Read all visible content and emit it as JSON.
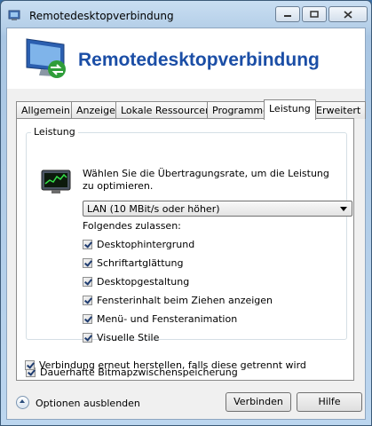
{
  "window": {
    "title": "Remotedesktopverbindung",
    "controls": {
      "minimize": "minimize-icon",
      "maximize": "maximize-icon",
      "close": "close-icon"
    }
  },
  "banner": {
    "title": "Remotedesktopverbindung",
    "icon": "remote-desktop-icon"
  },
  "tabs": [
    {
      "label": "Allgemein",
      "active": false
    },
    {
      "label": "Anzeige",
      "active": false
    },
    {
      "label": "Lokale Ressourcen",
      "active": false
    },
    {
      "label": "Programme",
      "active": false
    },
    {
      "label": "Leistung",
      "active": true
    },
    {
      "label": "Erweitert",
      "active": false
    }
  ],
  "performance": {
    "group_label": "Leistung",
    "description": "Wählen Sie die Übertragungsrate, um die Leistung zu optimieren.",
    "connection_speed": "LAN (10 MBit/s oder höher)",
    "allow_label": "Folgendes zulassen:",
    "options": [
      {
        "label": "Desktophintergrund",
        "checked": true
      },
      {
        "label": "Schriftartglättung",
        "checked": true
      },
      {
        "label": "Desktopgestaltung",
        "checked": true
      },
      {
        "label": "Fensterinhalt beim Ziehen anzeigen",
        "checked": true
      },
      {
        "label": "Menü- und Fensteranimation",
        "checked": true
      },
      {
        "label": "Visuelle Stile",
        "checked": true
      }
    ],
    "bitmap_cache": {
      "label": "Dauerhafte Bitmapzwischenspeicherung",
      "checked": true
    },
    "reconnect": {
      "label": "Verbindung erneut herstellen, falls diese getrennt wird",
      "checked": true
    }
  },
  "footer": {
    "options_toggle": "Optionen ausblenden",
    "connect_button": "Verbinden",
    "help_button": "Hilfe"
  },
  "colors": {
    "banner_title": "#1b4ea6",
    "window_frame": "#bcd6ef"
  }
}
